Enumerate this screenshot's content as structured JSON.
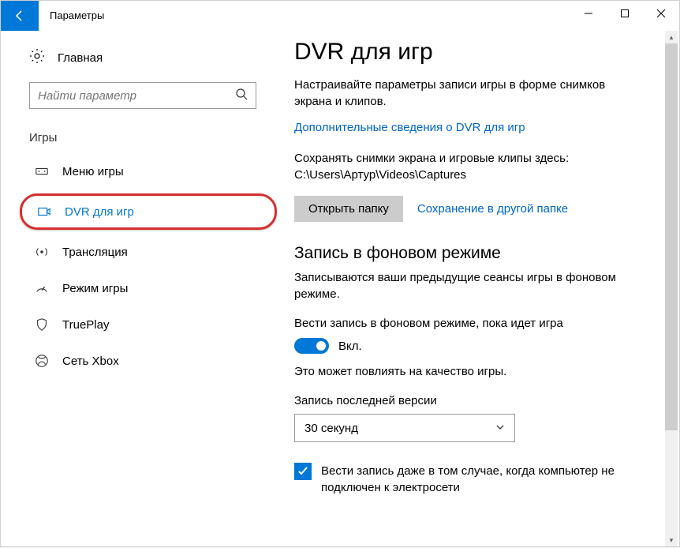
{
  "titlebar": {
    "title": "Параметры"
  },
  "sidebar": {
    "home": "Главная",
    "search_placeholder": "Найти параметр",
    "section": "Игры",
    "items": [
      {
        "label": "Меню игры"
      },
      {
        "label": "DVR для игр"
      },
      {
        "label": "Трансляция"
      },
      {
        "label": "Режим игры"
      },
      {
        "label": "TruePlay"
      },
      {
        "label": "Сеть Xbox"
      }
    ]
  },
  "content": {
    "heading": "DVR для игр",
    "lead": "Настраивайте параметры записи игры в форме снимков экрана и клипов.",
    "learn_more": "Дополнительные сведения о DVR для игр",
    "save_path": "Сохранять снимки экрана и игровые клипы здесь: C:\\Users\\Артур\\Videos\\Captures",
    "open_folder": "Открыть папку",
    "save_other": "Сохранение в другой папке",
    "bg_heading": "Запись в фоновом режиме",
    "bg_desc": "Записываются ваши предыдущие сеансы игры в фоновом режиме.",
    "toggle_label": "Вести запись в фоновом режиме, пока идет игра",
    "toggle_state": "Вкл.",
    "note": "Это может повлиять на качество игры.",
    "last_version_label": "Запись последней версии",
    "duration": "30 секунд",
    "checkbox_label": "Вести запись даже в том случае, когда компьютер не подключен к электросети"
  }
}
